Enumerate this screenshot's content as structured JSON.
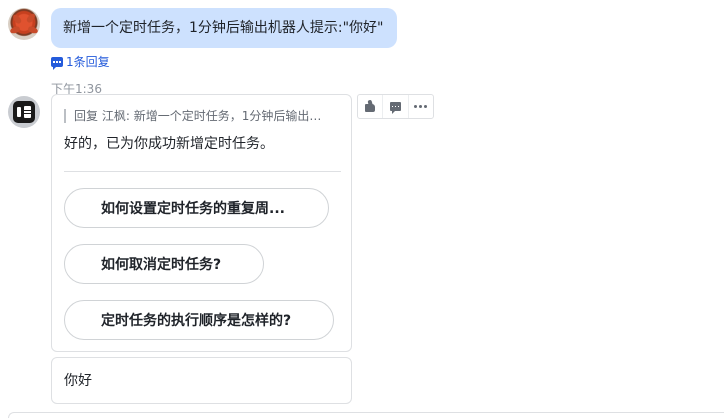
{
  "user_message": {
    "text": "新增一个定时任务，1分钟后输出机器人提示:\"你好\""
  },
  "thread": {
    "reply_count_label": "1条回复"
  },
  "timestamp": "下午1:36",
  "bot_message": {
    "quote_prefix": "回复 江枫:",
    "quote_text": "新增一个定时任务，1分钟后输出机...",
    "text": "好的，已为你成功新增定时任务。",
    "suggestions": [
      "如何设置定时任务的重复周...",
      "如何取消定时任务?",
      "定时任务的执行顺序是怎样的?"
    ]
  },
  "reply_card": {
    "text": "你好"
  },
  "toolbar": {
    "icons": [
      "thumbs-up-icon",
      "comment-icon",
      "more-icon"
    ]
  },
  "colors": {
    "user_bubble": "#cde1fe",
    "link_blue": "#245bdb",
    "border": "#dee0e3"
  }
}
